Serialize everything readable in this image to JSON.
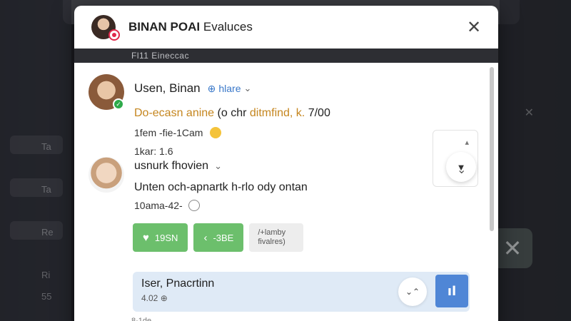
{
  "background": {
    "sidebar_glyphs": [
      "Ta",
      "Ta",
      "Re",
      "Ri",
      "55"
    ]
  },
  "header": {
    "title_bold": "BINAN POAI",
    "title_rest": "Evaluces",
    "close_glyph": "✕"
  },
  "band": {
    "text": "Fl11   Eineccac"
  },
  "post1": {
    "author": "Usen, Binan",
    "visibility": "hlare",
    "text_highlight": "Do-ecasn anine",
    "text_mid": "(o chr",
    "text_highlight2": "ditmfind, k.",
    "text_end": "7/00",
    "time": "1fem -fie-1Cam",
    "count": "1kar: 1.6",
    "side_caret": "▴",
    "side_button_glyph": "▼"
  },
  "post2": {
    "author": "usnurk fhovien",
    "text": "Unten och-apnartk h-rlo ody ontan",
    "time": "10ama-42-"
  },
  "actions": {
    "like_label": "19SN",
    "share_label": "-3BE",
    "more_label": "/+lamby fivalres)"
  },
  "card": {
    "name": "Iser, Pnacrtinn",
    "sub": "4.02 ⊕",
    "round_glyph": "⌄⌃",
    "square_glyph": "ıl"
  },
  "footer_peek": "8-1de"
}
